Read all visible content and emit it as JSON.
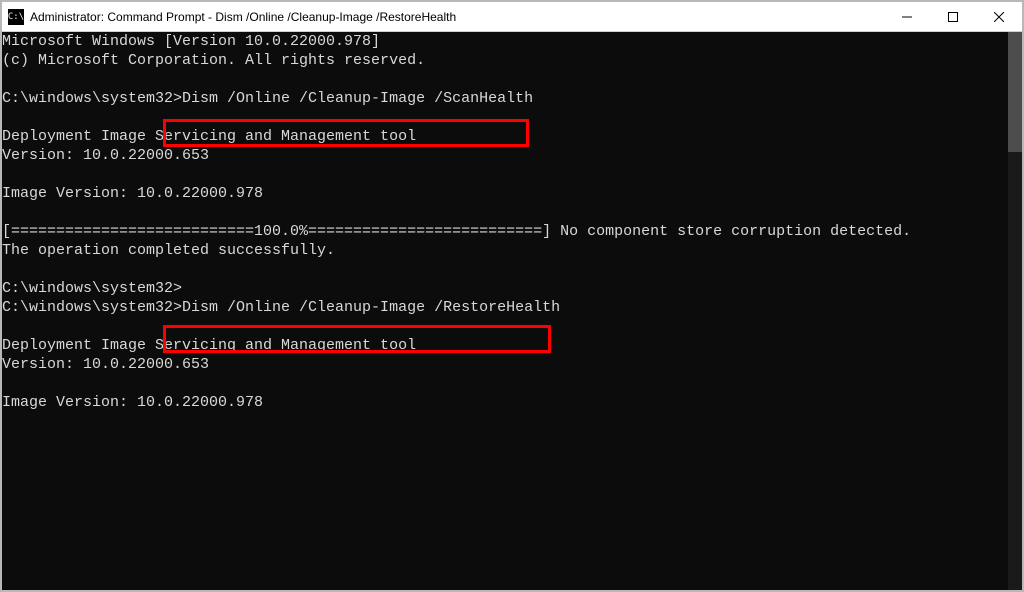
{
  "titlebar": {
    "icon_label": "cmd-icon",
    "title": "Administrator: Command Prompt - Dism  /Online /Cleanup-Image /RestoreHealth",
    "controls": {
      "min": "Minimize",
      "max": "Maximize",
      "close": "Close"
    }
  },
  "terminal": {
    "lines": [
      "Microsoft Windows [Version 10.0.22000.978]",
      "(c) Microsoft Corporation. All rights reserved.",
      "",
      "C:\\windows\\system32>Dism /Online /Cleanup-Image /ScanHealth",
      "",
      "Deployment Image Servicing and Management tool",
      "Version: 10.0.22000.653",
      "",
      "Image Version: 10.0.22000.978",
      "",
      "[===========================100.0%==========================] No component store corruption detected.",
      "The operation completed successfully.",
      "",
      "C:\\windows\\system32>",
      "C:\\windows\\system32>Dism /Online /Cleanup-Image /RestoreHealth",
      "",
      "Deployment Image Servicing and Management tool",
      "Version: 10.0.22000.653",
      "",
      "Image Version: 10.0.22000.978",
      ""
    ]
  },
  "highlights": {
    "cmd1": "Dism /Online /Cleanup-Image /ScanHealth",
    "cmd2": "Dism /Online /Cleanup-Image /RestoreHealth"
  }
}
